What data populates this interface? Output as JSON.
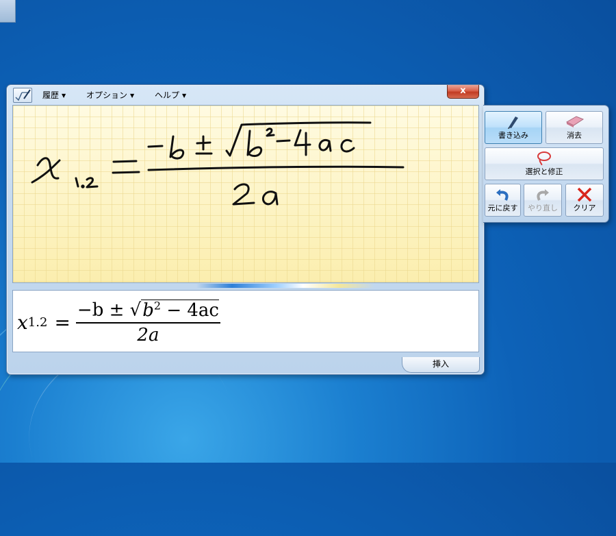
{
  "menu": {
    "history": "履歴",
    "options": "オプション",
    "help": "ヘルプ"
  },
  "window": {
    "close_label": "x"
  },
  "handwriting": {
    "left": "x",
    "subscript": "1.2",
    "numerator": "-b ± √b²-4ac",
    "denominator": "2a"
  },
  "preview": {
    "var": "x",
    "sub": "1.2",
    "eq": "=",
    "numerator": {
      "minus_b": "−b ± ",
      "radical": "√",
      "b": "b",
      "exp": "2",
      "rest": " − 4ac"
    },
    "denominator": "2a"
  },
  "tools": {
    "write": "書き込み",
    "erase": "消去",
    "select_correct": "選択と修正",
    "undo": "元に戻す",
    "redo": "やり直し",
    "clear": "クリア"
  },
  "insert_label": "挿入",
  "colors": {
    "undo_blue": "#2c6fc0",
    "clear_red": "#d8261c",
    "select_red": "#d83a3a",
    "redo_gray": "#a8a8a8"
  }
}
